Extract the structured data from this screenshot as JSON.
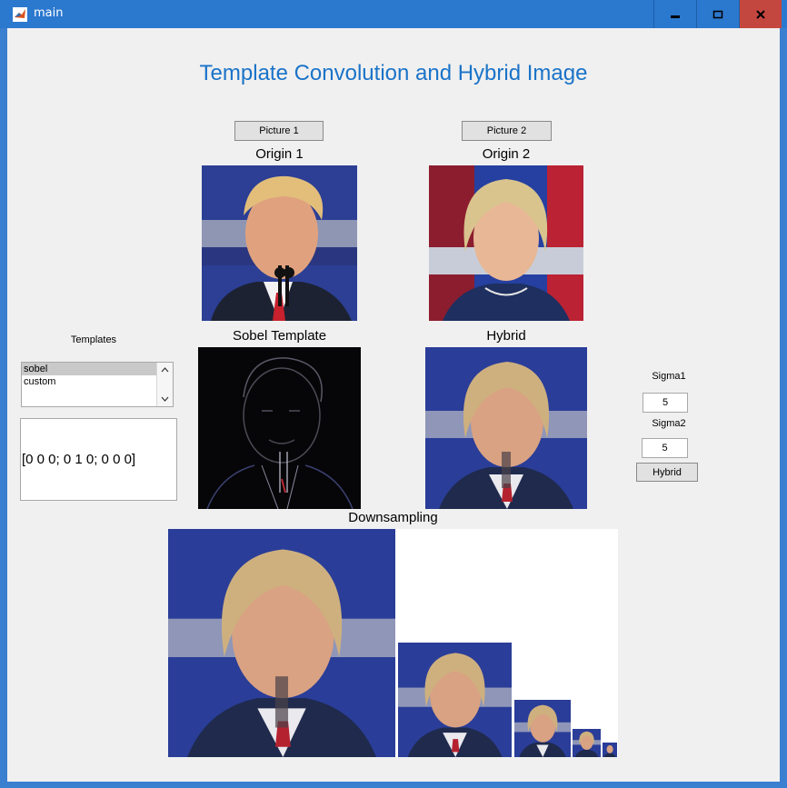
{
  "window": {
    "title": "main",
    "controls": [
      "minimize",
      "maximize",
      "close"
    ]
  },
  "page": {
    "title": "Template Convolution and Hybrid Image"
  },
  "buttons": {
    "picture1": "Picture 1",
    "picture2": "Picture 2",
    "hybrid": "Hybrid"
  },
  "labels": {
    "origin1": "Origin 1",
    "origin2": "Origin 2",
    "sobel": "Sobel Template",
    "hybrid": "Hybrid",
    "downsampling": "Downsampling",
    "templates": "Templates",
    "sigma1": "Sigma1",
    "sigma2": "Sigma2"
  },
  "templates_list": {
    "items": [
      "sobel",
      "custom"
    ],
    "selected": "sobel"
  },
  "template_matrix": "[0 0 0; 0 1 0; 0 0 0]",
  "inputs": {
    "sigma1": "5",
    "sigma2": "5"
  },
  "colors": {
    "accent": "#1a73c8",
    "titlebar": "#2b78cf",
    "close": "#c4473f",
    "panel": "#f0f0f0"
  }
}
